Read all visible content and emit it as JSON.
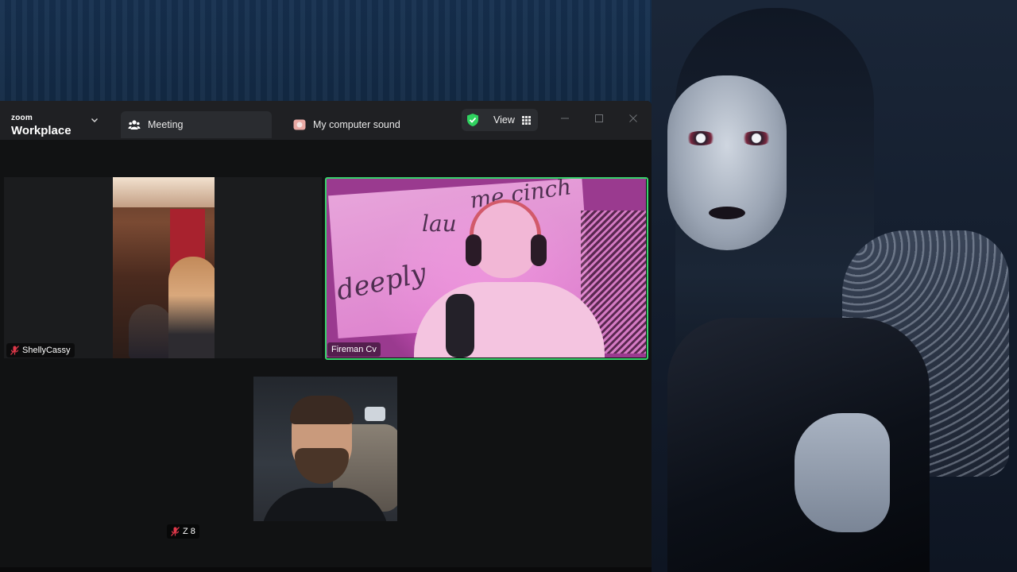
{
  "window": {
    "brand_top": "zoom",
    "brand_bottom": "Workplace",
    "controls": [
      "minimize-icon",
      "maximize-icon",
      "close-icon"
    ]
  },
  "tabs": {
    "meeting_label": "Meeting",
    "sound_label": "My computer sound"
  },
  "toolbar": {
    "view_label": "View",
    "security_color": "#2fd25f"
  },
  "participants": [
    {
      "name": "ShellyCassy",
      "muted": true
    },
    {
      "name": "Fireman Cv",
      "muted": false,
      "active_speaker": true
    },
    {
      "name": "Z 8",
      "muted": true
    }
  ],
  "banner_text": {
    "line1": "me cinch",
    "line2": "lau",
    "line3": "deeply"
  },
  "colors": {
    "active_speaker_border": "#38d36c",
    "muted_icon": "#e0384a"
  }
}
